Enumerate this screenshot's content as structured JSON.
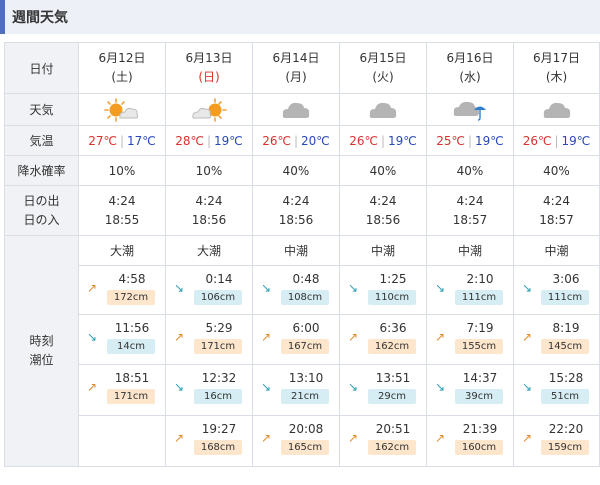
{
  "title": "週間天気",
  "labels": {
    "date": "日付",
    "weather": "天気",
    "temperature": "気温",
    "precip": "降水確率",
    "sunrise": "日の出",
    "sunset": "日の入",
    "tide_time": "時刻",
    "tide_level": "潮位"
  },
  "temp_sep": "|",
  "days": [
    {
      "date": "6月12日",
      "dow": "(土)",
      "dow_color": "#333333",
      "icon": "sun-cloud-icon",
      "hi": "27℃",
      "lo": "17℃",
      "precip": "10%",
      "sunrise": "4:24",
      "sunset": "18:55",
      "tide_type": "大潮",
      "tides": [
        {
          "time": "4:58",
          "level": "172cm",
          "dir": "up"
        },
        {
          "time": "11:56",
          "level": "14cm",
          "dir": "down"
        },
        {
          "time": "18:51",
          "level": "171cm",
          "dir": "up"
        }
      ]
    },
    {
      "date": "6月13日",
      "dow": "(日)",
      "dow_color": "#d9312e",
      "icon": "cloud-sun-icon",
      "hi": "28℃",
      "lo": "19℃",
      "precip": "10%",
      "sunrise": "4:24",
      "sunset": "18:56",
      "tide_type": "大潮",
      "tides": [
        {
          "time": "0:14",
          "level": "106cm",
          "dir": "down"
        },
        {
          "time": "5:29",
          "level": "171cm",
          "dir": "up"
        },
        {
          "time": "12:32",
          "level": "16cm",
          "dir": "down"
        },
        {
          "time": "19:27",
          "level": "168cm",
          "dir": "up"
        }
      ]
    },
    {
      "date": "6月14日",
      "dow": "(月)",
      "dow_color": "#333333",
      "icon": "cloud-icon",
      "hi": "26℃",
      "lo": "20℃",
      "precip": "40%",
      "sunrise": "4:24",
      "sunset": "18:56",
      "tide_type": "中潮",
      "tides": [
        {
          "time": "0:48",
          "level": "108cm",
          "dir": "down"
        },
        {
          "time": "6:00",
          "level": "167cm",
          "dir": "up"
        },
        {
          "time": "13:10",
          "level": "21cm",
          "dir": "down"
        },
        {
          "time": "20:08",
          "level": "165cm",
          "dir": "up"
        }
      ]
    },
    {
      "date": "6月15日",
      "dow": "(火)",
      "dow_color": "#333333",
      "icon": "cloud-icon",
      "hi": "26℃",
      "lo": "19℃",
      "precip": "40%",
      "sunrise": "4:24",
      "sunset": "18:56",
      "tide_type": "中潮",
      "tides": [
        {
          "time": "1:25",
          "level": "110cm",
          "dir": "down"
        },
        {
          "time": "6:36",
          "level": "162cm",
          "dir": "up"
        },
        {
          "time": "13:51",
          "level": "29cm",
          "dir": "down"
        },
        {
          "time": "20:51",
          "level": "162cm",
          "dir": "up"
        }
      ]
    },
    {
      "date": "6月16日",
      "dow": "(水)",
      "dow_color": "#333333",
      "icon": "cloud-rain-icon",
      "hi": "25℃",
      "lo": "19℃",
      "precip": "40%",
      "sunrise": "4:24",
      "sunset": "18:57",
      "tide_type": "中潮",
      "tides": [
        {
          "time": "2:10",
          "level": "111cm",
          "dir": "down"
        },
        {
          "time": "7:19",
          "level": "155cm",
          "dir": "up"
        },
        {
          "time": "14:37",
          "level": "39cm",
          "dir": "down"
        },
        {
          "time": "21:39",
          "level": "160cm",
          "dir": "up"
        }
      ]
    },
    {
      "date": "6月17日",
      "dow": "(木)",
      "dow_color": "#333333",
      "icon": "cloud-icon",
      "hi": "26℃",
      "lo": "19℃",
      "precip": "40%",
      "sunrise": "4:24",
      "sunset": "18:57",
      "tide_type": "中潮",
      "tides": [
        {
          "time": "3:06",
          "level": "111cm",
          "dir": "down"
        },
        {
          "time": "8:19",
          "level": "145cm",
          "dir": "up"
        },
        {
          "time": "15:28",
          "level": "51cm",
          "dir": "down"
        },
        {
          "time": "22:20",
          "level": "159cm",
          "dir": "up"
        }
      ]
    }
  ]
}
